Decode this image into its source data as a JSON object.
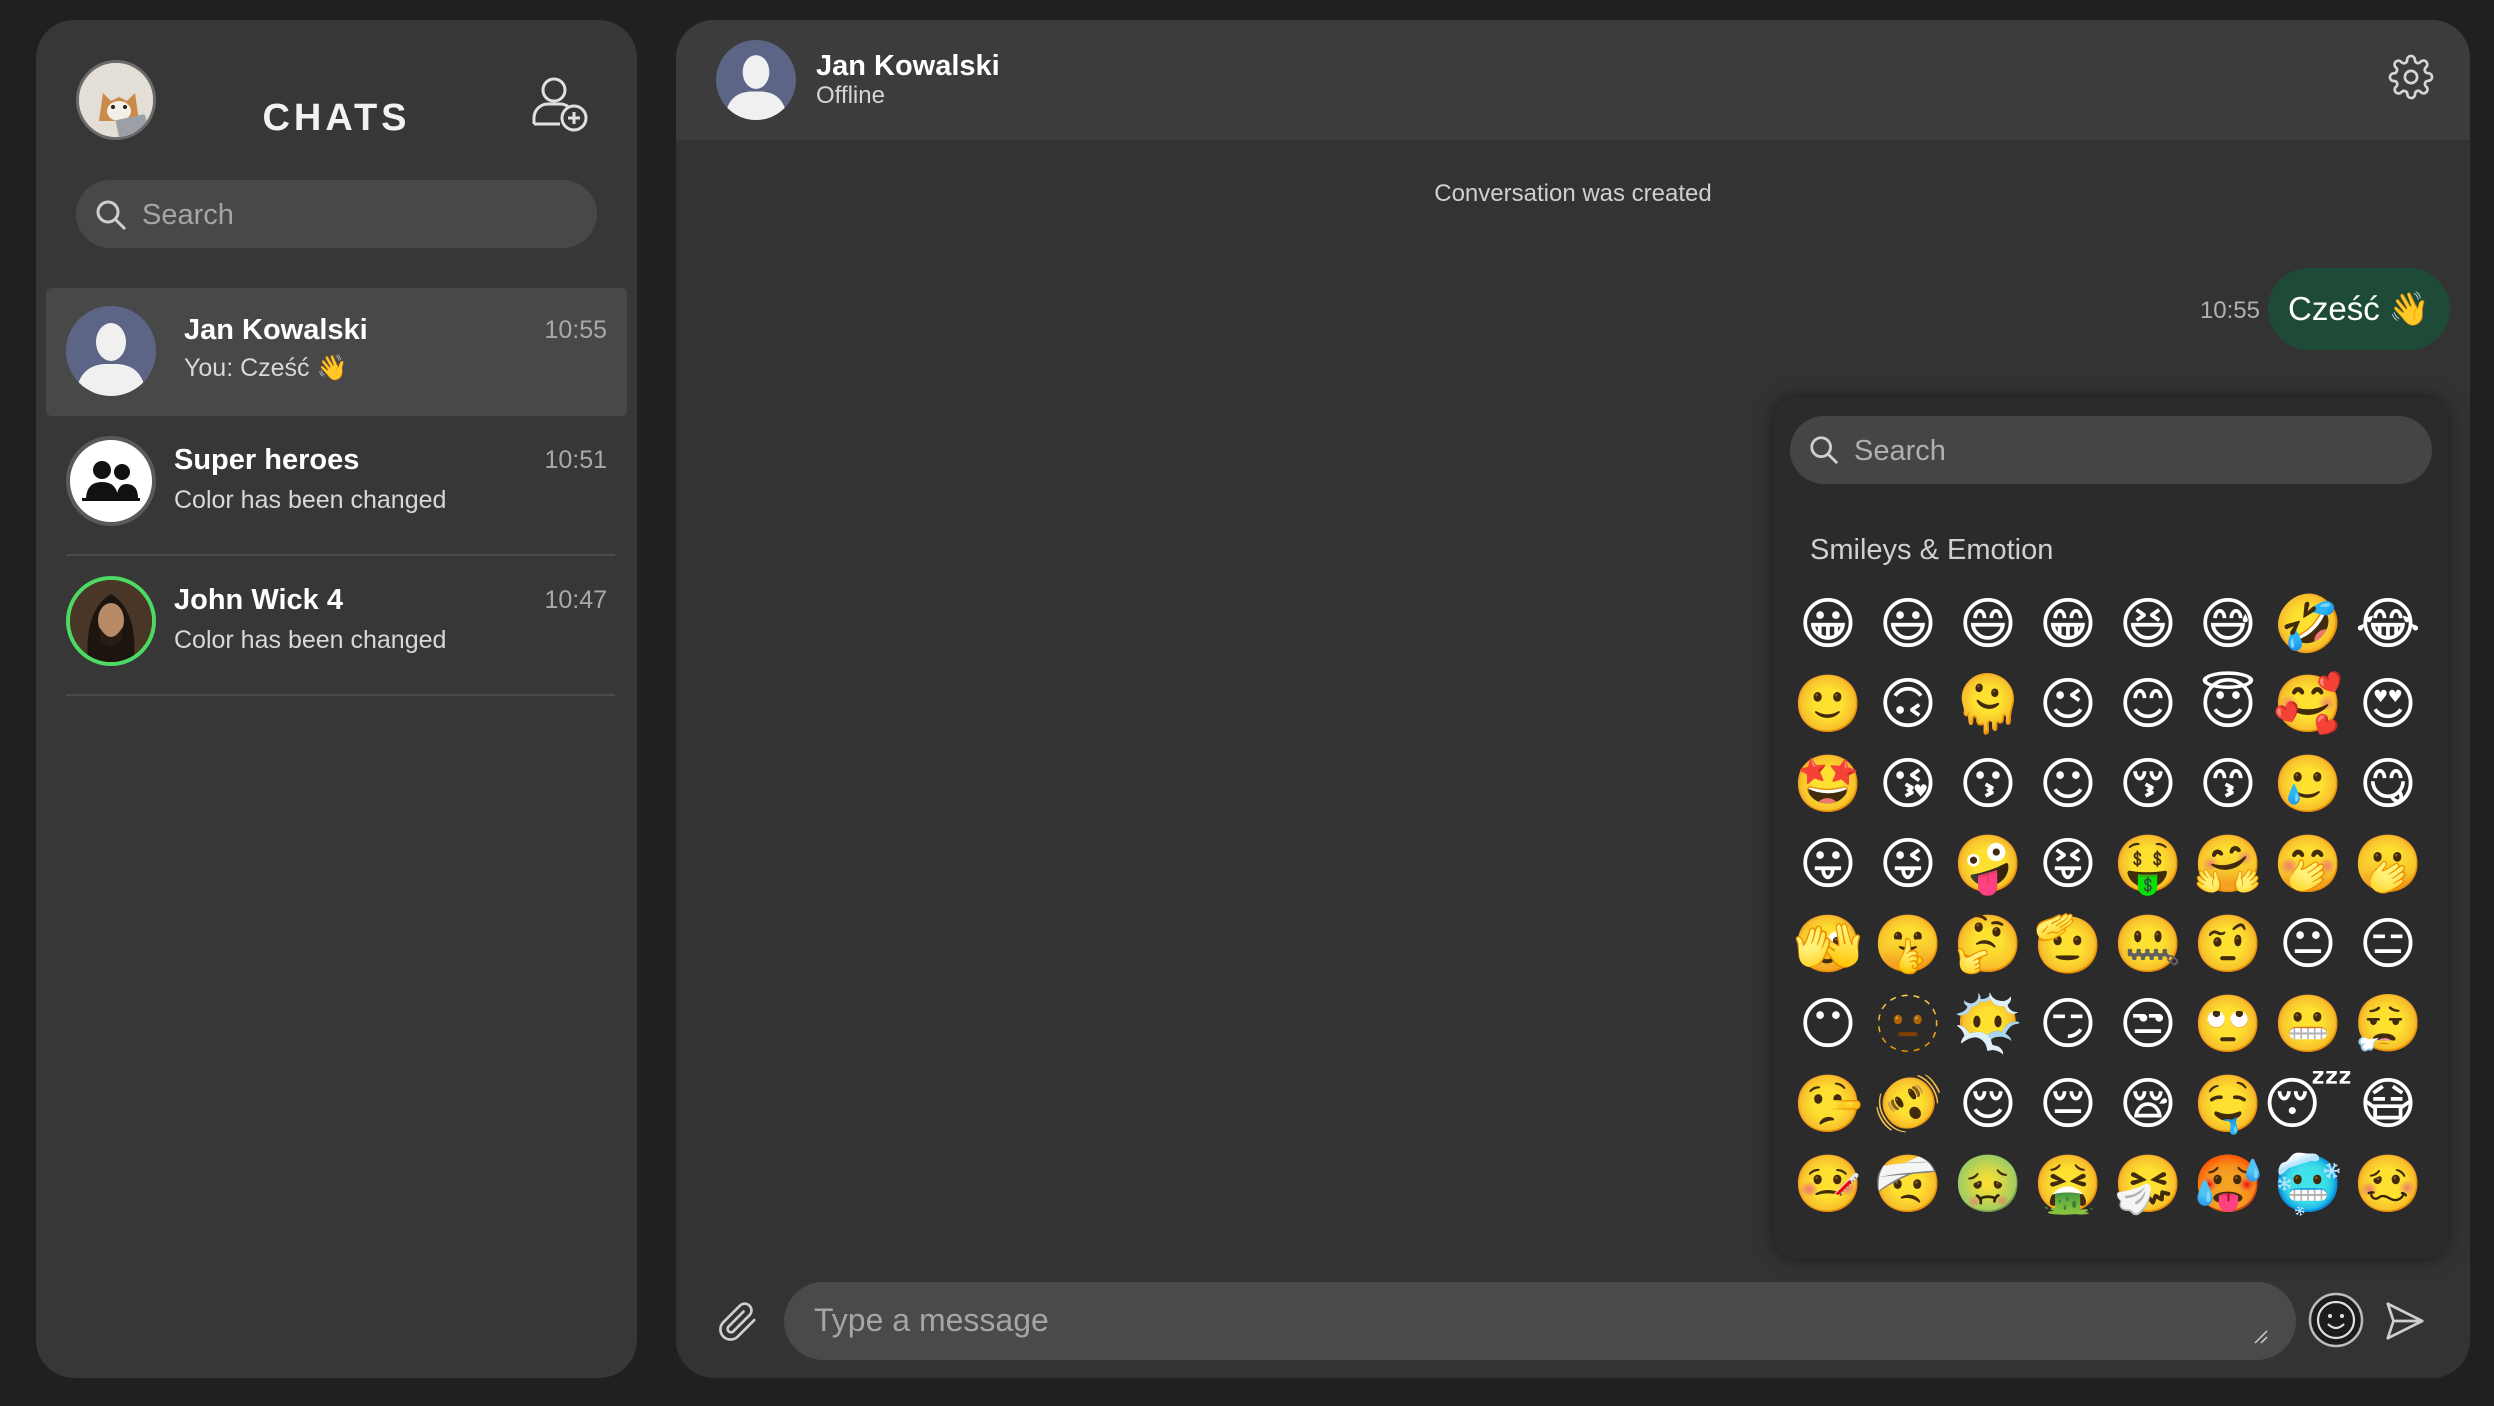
{
  "sidebar": {
    "title": "CHATS",
    "search_placeholder": "Search",
    "chats": [
      {
        "name": "Jan Kowalski",
        "time": "10:55",
        "last": "You: Cześć 👋",
        "active": true
      },
      {
        "name": "Super heroes",
        "time": "10:51",
        "last": "Color has been changed"
      },
      {
        "name": "John Wick 4",
        "time": "10:47",
        "last": "Color has been changed"
      }
    ]
  },
  "conversation": {
    "name": "Jan Kowalski",
    "status": "Offline",
    "system_message": "Conversation was created",
    "messages": [
      {
        "text": "Cześć 👋",
        "time": "10:55",
        "outgoing": true
      }
    ]
  },
  "emoji_picker": {
    "search_placeholder": "Search",
    "category": "Smileys & Emotion",
    "emojis": [
      "😀",
      "😃",
      "😄",
      "😁",
      "😆",
      "😅",
      "🤣",
      "😂",
      "🙂",
      "🙃",
      "🫠",
      "😉",
      "😊",
      "😇",
      "🥰",
      "😍",
      "🤩",
      "😘",
      "😗",
      "☺",
      "😚",
      "😙",
      "🥲",
      "😋",
      "😛",
      "😜",
      "🤪",
      "😝",
      "🤑",
      "🤗",
      "🤭",
      "🫢",
      "🫣",
      "🤫",
      "🤔",
      "🫡",
      "🤐",
      "🤨",
      "😐",
      "😑",
      "😶",
      "🫥",
      "😶‍🌫️",
      "😏",
      "😒",
      "🙄",
      "😬",
      "😮‍💨",
      "🤥",
      "🫨",
      "😌",
      "😔",
      "😪",
      "🤤",
      "😴",
      "😷",
      "🤒",
      "🤕",
      "🤢",
      "🤮",
      "🤧",
      "🥵",
      "🥶",
      "🥴"
    ]
  },
  "composer": {
    "placeholder": "Type a message"
  },
  "colors": {
    "background": "#202020",
    "panel": "#373737",
    "bubble_outgoing": "#1e4b37",
    "online_ring": "#4cd964"
  }
}
